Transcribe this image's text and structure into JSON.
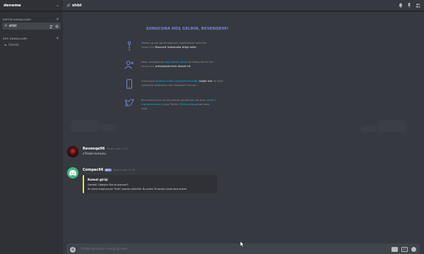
{
  "server": {
    "name": "deneme"
  },
  "sidebar": {
    "text_category": "METİN KANALLARI",
    "voice_category": "SES KANALLARI",
    "text_channels": [
      {
        "name": "shbt"
      }
    ],
    "voice_channels": [
      {
        "name": "Genel"
      }
    ]
  },
  "channel": {
    "name": "shbt"
  },
  "welcome": {
    "title": "SUNUCUNA HOŞ GELDİN, REVENQE96!",
    "rows": [
      {
        "icon": "tip-icon",
        "t1": "Sözleri güzel görünüyorsun; keşfedecek sıfat ğın",
        "t2": "hepsi için ",
        "bold": "Discord hakkında bilgi edin",
        "t3": "."
      },
      {
        "icon": "invite-icon",
        "t1": "Hazır olduğunda ",
        "link": "sağ üstteki davet",
        "t2": " ile takipçilerine bu",
        "t3": "sunucuyu ",
        "bold": "arkadaşlarınla davet et",
        "t4": "."
      },
      {
        "icon": "mobile-icon",
        "t1": "Sunucuna ",
        "link": "ücretsiz mobil uygulamamızdan",
        "bold": " bağlı kal",
        "t2": " ve ilgini",
        "t3": "çekenleri listelenen tüm Discord'u kursun."
      },
      {
        "icon": "twitter-icon",
        "t1": "Bu sunucu'nun ya da yardım gerektiyor ise bize ",
        "link": "yardım",
        "t2": "",
        "link2": "merkezimizden",
        "t3": " veya Twitter ",
        "link3": "@discordapp",
        "t4": "'den bize",
        "t5": "ulaş."
      }
    ]
  },
  "messages": [
    {
      "author": "Revenqe96",
      "timestamp": "Bugün saat 17:50",
      "text": "c!hazir-sunucu"
    },
    {
      "author": "Compac96",
      "badge": "BOT",
      "timestamp": "Bugün saat 17:50",
      "embed": {
        "title": "Komut girişi",
        "description": "Gerekli Odaşlar Kuruluyorsun?",
        "footer": "Bu işlemi onaylıyorsan \"Evet\" yazman yeterlidir. Bu eylem 30 saniye içinde sona erecek"
      }
    }
  ],
  "input": {
    "placeholder": "#shbt kanalına mesaj gönder"
  },
  "colors": {
    "accent": "#7289da",
    "embed_bar": "#e8e839",
    "bot_green": "#43b581"
  }
}
